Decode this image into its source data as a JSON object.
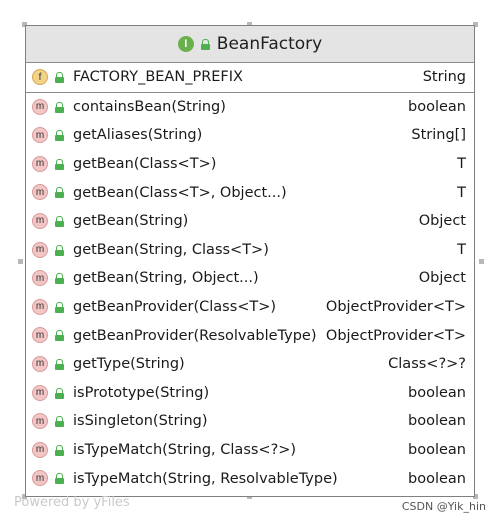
{
  "class_name": "BeanFactory",
  "class_kind_icon": "interface-icon",
  "fields": [
    {
      "name": "FACTORY_BEAN_PREFIX",
      "type": "String"
    }
  ],
  "methods": [
    {
      "name": "containsBean(String)",
      "type": "boolean"
    },
    {
      "name": "getAliases(String)",
      "type": "String[]"
    },
    {
      "name": "getBean(Class<T>)",
      "type": "T"
    },
    {
      "name": "getBean(Class<T>, Object...)",
      "type": "T"
    },
    {
      "name": "getBean(String)",
      "type": "Object"
    },
    {
      "name": "getBean(String, Class<T>)",
      "type": "T"
    },
    {
      "name": "getBean(String, Object...)",
      "type": "Object"
    },
    {
      "name": "getBeanProvider(Class<T>)",
      "type": "ObjectProvider<T>"
    },
    {
      "name": "getBeanProvider(ResolvableType)",
      "type": "ObjectProvider<T>"
    },
    {
      "name": "getType(String)",
      "type": "Class<?>?"
    },
    {
      "name": "isPrototype(String)",
      "type": "boolean"
    },
    {
      "name": "isSingleton(String)",
      "type": "boolean"
    },
    {
      "name": "isTypeMatch(String, Class<?>)",
      "type": "boolean"
    },
    {
      "name": "isTypeMatch(String, ResolvableType)",
      "type": "boolean"
    }
  ],
  "footer_left": "Powered by yFiles",
  "footer_right": "CSDN @Yik_hin",
  "colors": {
    "header_bg": "#e4e4e4",
    "method_icon": "#f3c6c6",
    "field_icon": "#f3d28a",
    "public_lock": "#4caf50",
    "interface_icon": "#6ab04c"
  }
}
